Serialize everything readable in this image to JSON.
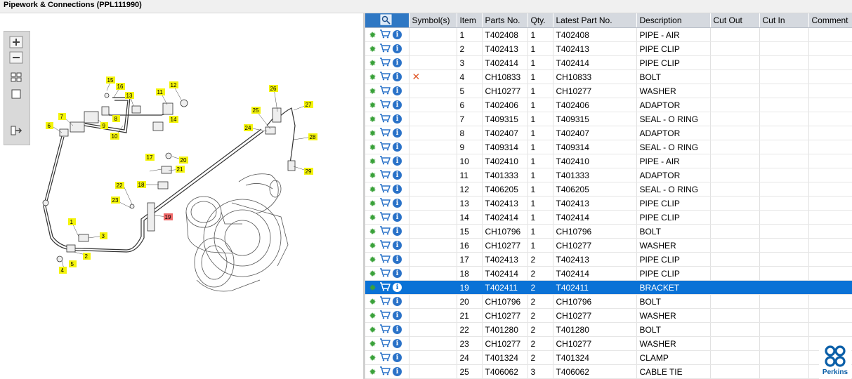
{
  "window": {
    "title": "Pipework & Connections (PPL111990)"
  },
  "toolbar": {
    "icons": [
      "zoom-in-icon",
      "zoom-out-icon",
      "fit-all-icon",
      "fit-box-icon",
      "export-icon"
    ]
  },
  "diagram": {
    "callouts": [
      "1",
      "2",
      "3",
      "4",
      "5",
      "6",
      "7",
      "8",
      "9",
      "10",
      "11",
      "12",
      "13",
      "14",
      "15",
      "16",
      "17",
      "18",
      "19",
      "20",
      "21",
      "22",
      "23",
      "24",
      "25",
      "26",
      "27",
      "28",
      "29"
    ],
    "selected_callout": "19"
  },
  "table": {
    "headers": [
      "Symbol(s)",
      "Item",
      "Parts No.",
      "Qty.",
      "Latest Part No.",
      "Description",
      "Cut Out",
      "Cut In",
      "Comment"
    ],
    "selected_item": "19",
    "rows": [
      {
        "symbol": "",
        "item": "1",
        "part": "T402408",
        "qty": "1",
        "latest": "T402408",
        "desc": "PIPE - AIR"
      },
      {
        "symbol": "",
        "item": "2",
        "part": "T402413",
        "qty": "1",
        "latest": "T402413",
        "desc": "PIPE CLIP"
      },
      {
        "symbol": "",
        "item": "3",
        "part": "T402414",
        "qty": "1",
        "latest": "T402414",
        "desc": "PIPE CLIP"
      },
      {
        "symbol": "✕",
        "item": "4",
        "part": "CH10833",
        "qty": "1",
        "latest": "CH10833",
        "desc": "BOLT"
      },
      {
        "symbol": "",
        "item": "5",
        "part": "CH10277",
        "qty": "1",
        "latest": "CH10277",
        "desc": "WASHER"
      },
      {
        "symbol": "",
        "item": "6",
        "part": "T402406",
        "qty": "1",
        "latest": "T402406",
        "desc": "ADAPTOR"
      },
      {
        "symbol": "",
        "item": "7",
        "part": "T409315",
        "qty": "1",
        "latest": "T409315",
        "desc": "SEAL - O RING"
      },
      {
        "symbol": "",
        "item": "8",
        "part": "T402407",
        "qty": "1",
        "latest": "T402407",
        "desc": "ADAPTOR"
      },
      {
        "symbol": "",
        "item": "9",
        "part": "T409314",
        "qty": "1",
        "latest": "T409314",
        "desc": "SEAL - O RING"
      },
      {
        "symbol": "",
        "item": "10",
        "part": "T402410",
        "qty": "1",
        "latest": "T402410",
        "desc": "PIPE - AIR"
      },
      {
        "symbol": "",
        "item": "11",
        "part": "T401333",
        "qty": "1",
        "latest": "T401333",
        "desc": "ADAPTOR"
      },
      {
        "symbol": "",
        "item": "12",
        "part": "T406205",
        "qty": "1",
        "latest": "T406205",
        "desc": "SEAL - O RING"
      },
      {
        "symbol": "",
        "item": "13",
        "part": "T402413",
        "qty": "1",
        "latest": "T402413",
        "desc": "PIPE CLIP"
      },
      {
        "symbol": "",
        "item": "14",
        "part": "T402414",
        "qty": "1",
        "latest": "T402414",
        "desc": "PIPE CLIP"
      },
      {
        "symbol": "",
        "item": "15",
        "part": "CH10796",
        "qty": "1",
        "latest": "CH10796",
        "desc": "BOLT"
      },
      {
        "symbol": "",
        "item": "16",
        "part": "CH10277",
        "qty": "1",
        "latest": "CH10277",
        "desc": "WASHER"
      },
      {
        "symbol": "",
        "item": "17",
        "part": "T402413",
        "qty": "2",
        "latest": "T402413",
        "desc": "PIPE CLIP"
      },
      {
        "symbol": "",
        "item": "18",
        "part": "T402414",
        "qty": "2",
        "latest": "T402414",
        "desc": "PIPE CLIP"
      },
      {
        "symbol": "",
        "item": "19",
        "part": "T402411",
        "qty": "2",
        "latest": "T402411",
        "desc": "BRACKET"
      },
      {
        "symbol": "",
        "item": "20",
        "part": "CH10796",
        "qty": "2",
        "latest": "CH10796",
        "desc": "BOLT"
      },
      {
        "symbol": "",
        "item": "21",
        "part": "CH10277",
        "qty": "2",
        "latest": "CH10277",
        "desc": "WASHER"
      },
      {
        "symbol": "",
        "item": "22",
        "part": "T401280",
        "qty": "2",
        "latest": "T401280",
        "desc": "BOLT"
      },
      {
        "symbol": "",
        "item": "23",
        "part": "CH10277",
        "qty": "2",
        "latest": "CH10277",
        "desc": "WASHER"
      },
      {
        "symbol": "",
        "item": "24",
        "part": "T401324",
        "qty": "2",
        "latest": "T401324",
        "desc": "CLAMP"
      },
      {
        "symbol": "",
        "item": "25",
        "part": "T406062",
        "qty": "3",
        "latest": "T406062",
        "desc": "CABLE TIE"
      }
    ]
  },
  "brand": {
    "name": "Perkins",
    "color": "#0b5fa8"
  },
  "colors": {
    "selection": "#0a72d6",
    "callout": "#f4f40a",
    "callout_selected": "#f06a6a"
  }
}
